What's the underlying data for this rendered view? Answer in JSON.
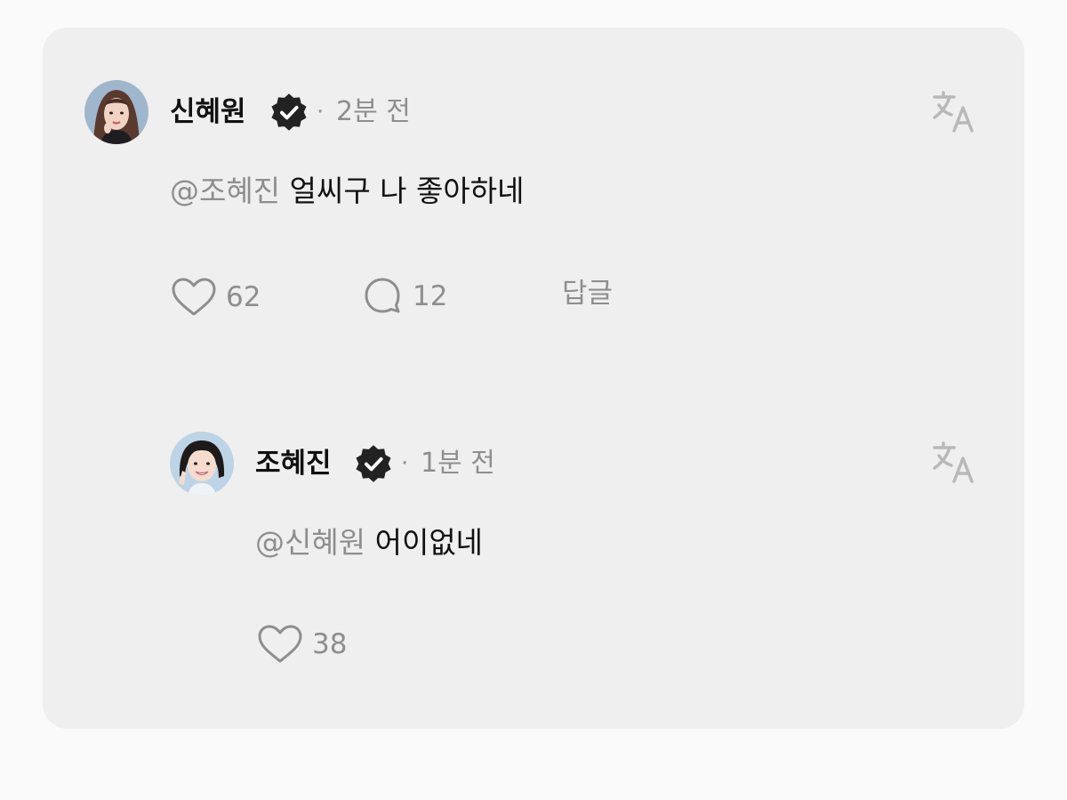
{
  "comment": {
    "author": "신혜원",
    "time": "2분 전",
    "separator": "·",
    "mention": "@조혜진",
    "text": "얼씨구 나 좋아하네",
    "likes": "62",
    "replies": "12",
    "reply_label": "답글",
    "verified_icon": "verified-badge-icon",
    "translate_icon": "translate-icon"
  },
  "reply": {
    "author": "조혜진",
    "time": "1분 전",
    "separator": "·",
    "mention": "@신혜원",
    "text": "어이없네",
    "likes": "38",
    "verified_icon": "verified-badge-icon",
    "translate_icon": "translate-icon"
  },
  "colors": {
    "background": "#fafafa",
    "card": "#efefef",
    "text": "#111111",
    "muted": "#8e8e8e"
  }
}
